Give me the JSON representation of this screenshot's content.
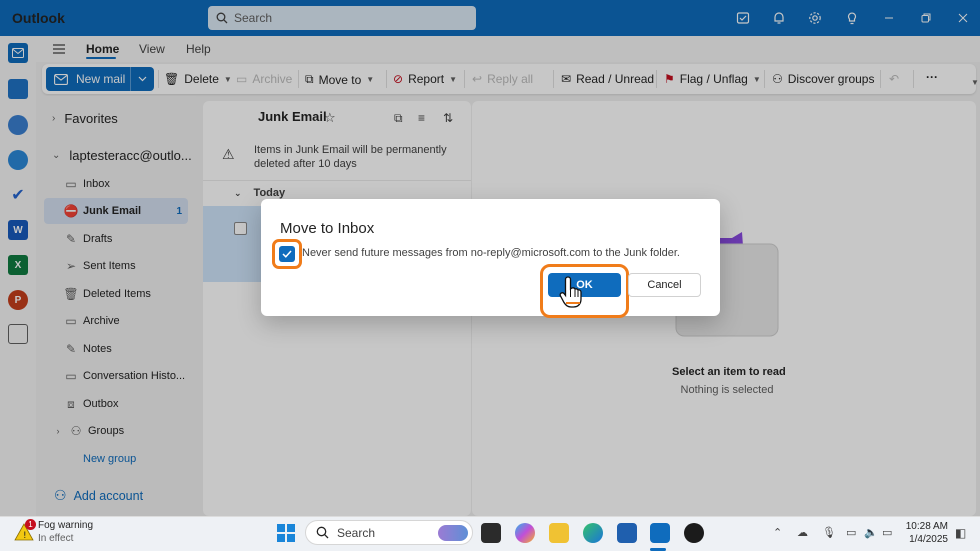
{
  "app": {
    "title": "Outlook"
  },
  "search": {
    "placeholder": "Search"
  },
  "ribbon": {
    "tabs": [
      "Home",
      "View",
      "Help"
    ],
    "new_mail": "New mail",
    "delete": "Delete",
    "archive": "Archive",
    "move_to": "Move to",
    "report": "Report",
    "reply_all": "Reply all",
    "read_unread": "Read / Unread",
    "flag_unflag": "Flag / Unflag",
    "discover_groups": "Discover groups",
    "more": "···"
  },
  "folders": {
    "favorites": "Favorites",
    "account": "laptesteracc@outlo...",
    "items": [
      {
        "label": "Inbox",
        "icon": "inbox-icon"
      },
      {
        "label": "Junk Email",
        "icon": "junk-icon",
        "count": "1"
      },
      {
        "label": "Drafts",
        "icon": "drafts-icon"
      },
      {
        "label": "Sent Items",
        "icon": "sent-icon"
      },
      {
        "label": "Deleted Items",
        "icon": "trash-icon"
      },
      {
        "label": "Archive",
        "icon": "archive-icon"
      },
      {
        "label": "Notes",
        "icon": "notes-icon"
      },
      {
        "label": "Conversation Histo...",
        "icon": "folder-icon"
      },
      {
        "label": "Outbox",
        "icon": "outbox-icon"
      },
      {
        "label": "Groups",
        "icon": "groups-icon"
      }
    ],
    "new_group": "New group",
    "add_account": "Add account"
  },
  "message_list": {
    "title": "Junk Email",
    "notice": "Items in Junk Email will be permanently deleted after 10 days",
    "group_header": "Today"
  },
  "reading_pane": {
    "title": "Select an item to read",
    "subtitle": "Nothing is selected"
  },
  "dialog": {
    "title": "Move to Inbox",
    "checkbox_label": "Never send future messages from no-reply@microsoft.com to the Junk folder.",
    "checkbox_checked": true,
    "ok": "OK",
    "cancel": "Cancel"
  },
  "taskbar": {
    "weather_title": "Fog warning",
    "weather_sub": "In effect",
    "weather_badge": "1",
    "search": "Search",
    "time": "10:28 AM",
    "date": "1/4/2025"
  },
  "colors": {
    "brand": "#0f6cbd",
    "highlight": "#f07c1a"
  }
}
